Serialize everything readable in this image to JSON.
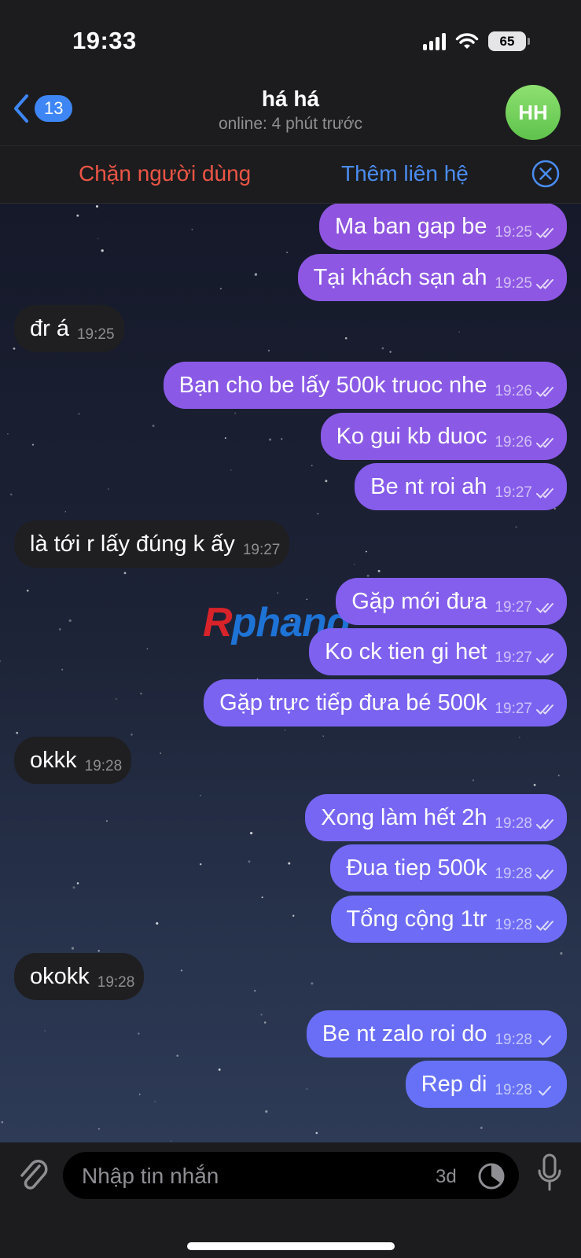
{
  "status_bar": {
    "time": "19:33",
    "battery": "65"
  },
  "header": {
    "back_badge": "13",
    "title": "há há",
    "subtitle": "online: 4 phút trước",
    "avatar_initials": "HH"
  },
  "actions": {
    "block": "Chặn người dùng",
    "add_contact": "Thêm liên hệ"
  },
  "watermark": {
    "part1": "R",
    "part2": "phang"
  },
  "messages": [
    {
      "dir": "out",
      "text": "Ma ban gap be",
      "time": "19:25",
      "ticks": "double"
    },
    {
      "dir": "out",
      "text": "Tại khách sạn ah",
      "time": "19:25",
      "ticks": "double"
    },
    {
      "dir": "in",
      "text": "đr á",
      "time": "19:25"
    },
    {
      "dir": "out",
      "text": "Bạn cho be lấy 500k truoc nhe",
      "time": "19:26",
      "ticks": "double"
    },
    {
      "dir": "out",
      "text": "Ko gui kb duoc",
      "time": "19:26",
      "ticks": "double"
    },
    {
      "dir": "out",
      "text": "Be nt roi ah",
      "time": "19:27",
      "ticks": "double"
    },
    {
      "dir": "in",
      "text": "là tới r lấy đúng k ấy",
      "time": "19:27"
    },
    {
      "dir": "out",
      "text": "Gặp mới đưa",
      "time": "19:27",
      "ticks": "double"
    },
    {
      "dir": "out",
      "text": "Ko ck tien gi het",
      "time": "19:27",
      "ticks": "double"
    },
    {
      "dir": "out",
      "text": "Gặp trực tiếp đưa bé 500k",
      "time": "19:27",
      "ticks": "double"
    },
    {
      "dir": "in",
      "text": "okkk",
      "time": "19:28"
    },
    {
      "dir": "out",
      "text": "Xong làm hết 2h",
      "time": "19:28",
      "ticks": "double"
    },
    {
      "dir": "out",
      "text": "Đua tiep 500k",
      "time": "19:28",
      "ticks": "double"
    },
    {
      "dir": "out",
      "text": "Tổng cộng 1tr",
      "time": "19:28",
      "ticks": "double"
    },
    {
      "dir": "in",
      "text": "okokk",
      "time": "19:28"
    },
    {
      "dir": "out",
      "text": "Be nt zalo roi do",
      "time": "19:28",
      "ticks": "single"
    },
    {
      "dir": "out",
      "text": "Rep di",
      "time": "19:28",
      "ticks": "single"
    }
  ],
  "input": {
    "placeholder": "Nhập tin nhắn",
    "timer": "3d"
  },
  "icons": {
    "back": "chevron-left-icon",
    "close": "close-circle-icon",
    "attach": "paperclip-icon",
    "timer": "self-destruct-timer-icon",
    "mic": "microphone-icon",
    "read": "double-check-icon",
    "sent": "single-check-icon"
  }
}
